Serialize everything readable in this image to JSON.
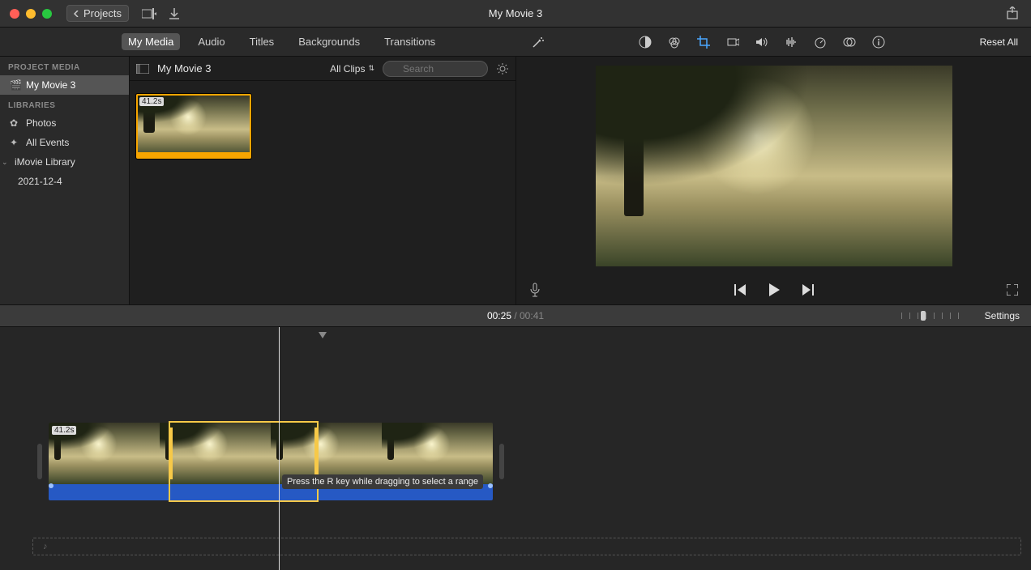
{
  "titlebar": {
    "project_back": "Projects",
    "title": "My Movie 3"
  },
  "tabs": {
    "my_media": "My Media",
    "audio": "Audio",
    "titles": "Titles",
    "backgrounds": "Backgrounds",
    "transitions": "Transitions"
  },
  "adjust": {
    "reset": "Reset All"
  },
  "sidebar": {
    "project_media_heading": "PROJECT MEDIA",
    "project_name": "My Movie 3",
    "libraries_heading": "LIBRARIES",
    "photos": "Photos",
    "all_events": "All Events",
    "imovie_library": "iMovie Library",
    "event_date": "2021-12-4"
  },
  "browser": {
    "title": "My Movie 3",
    "filter": "All Clips",
    "search_placeholder": "Search",
    "clip_duration": "41.2s"
  },
  "status": {
    "current": "00:25",
    "sep": " / ",
    "total": "00:41",
    "settings": "Settings"
  },
  "timeline": {
    "clip_duration": "41.2s",
    "tooltip": "Press the R key while dragging to select a range"
  }
}
